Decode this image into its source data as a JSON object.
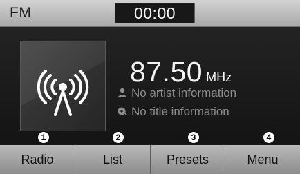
{
  "status": {
    "band": "FM",
    "clock": "00:00"
  },
  "station": {
    "icon": "radio-antenna-icon",
    "frequency": "87.50",
    "unit": "MHz",
    "artist": "No artist information",
    "title": "No title information"
  },
  "callouts": [
    "1",
    "2",
    "3",
    "4"
  ],
  "softkeys": [
    "Radio",
    "List",
    "Presets",
    "Menu"
  ]
}
